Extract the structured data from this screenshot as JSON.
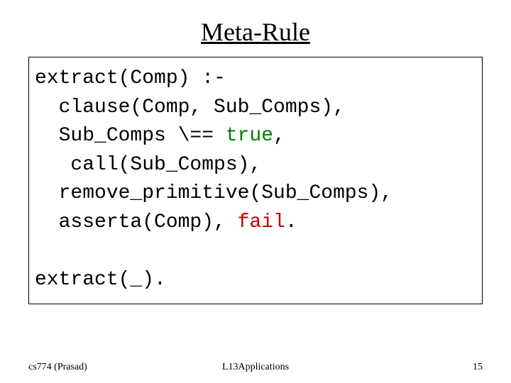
{
  "title": "Meta-Rule",
  "code": {
    "l1a": "extract(Comp) :-",
    "l2a": "  clause(Comp, Sub_Comps),",
    "l3a": "  Sub_Comps \\== ",
    "l3b": "true",
    "l3c": ",",
    "l4a": "   call(Sub_Comps),",
    "l5a": "  remove_primitive(Sub_Comps),",
    "l6a": "  asserta(Comp), ",
    "l6b": "fail",
    "l6c": ".",
    "blank": "",
    "l7a": "extract(_)."
  },
  "footer": {
    "left": "cs774 (Prasad)",
    "center": "L13Applications",
    "right": "15"
  }
}
